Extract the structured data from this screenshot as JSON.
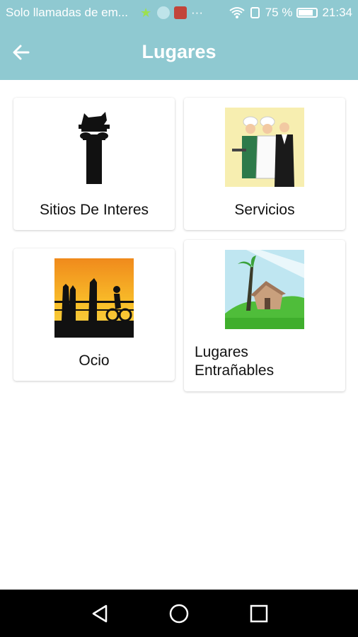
{
  "status": {
    "carrier_text": "Solo llamadas de em...",
    "more": "···",
    "battery_percent": "75 %",
    "battery_level": 0.75,
    "time": "21:34"
  },
  "app_bar": {
    "title": "Lugares",
    "background": "#8fc9d1"
  },
  "cards": [
    {
      "label": "Sitios De Interes",
      "icon": "roman-column-icon"
    },
    {
      "label": "Servicios",
      "icon": "chefs-waiter-icon"
    },
    {
      "label": "Ocio",
      "icon": "sunset-silhouettes-icon"
    },
    {
      "label": "Lugares\nEntrañables",
      "icon": "hut-palm-icon"
    }
  ]
}
